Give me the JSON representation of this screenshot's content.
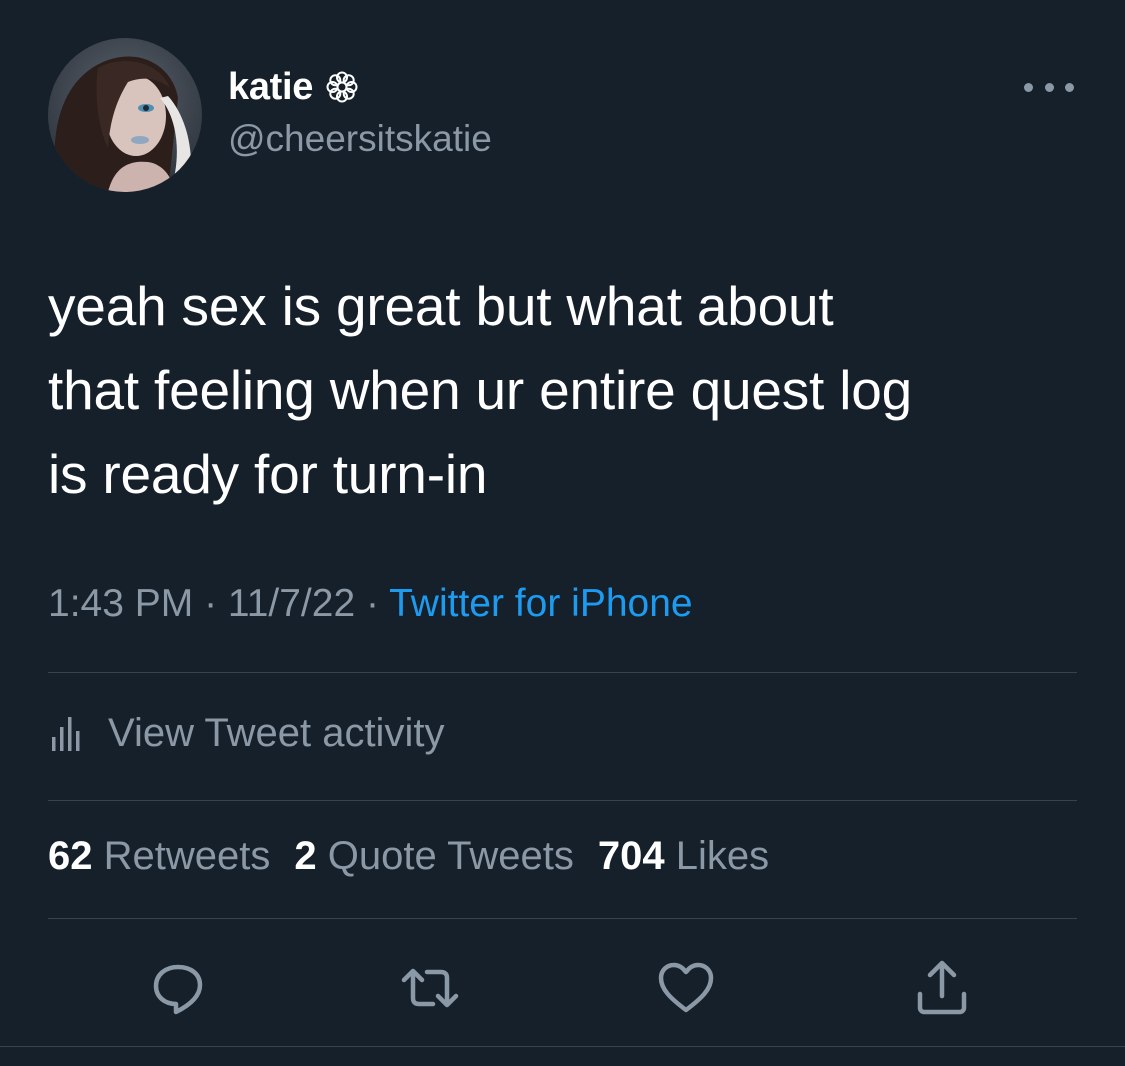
{
  "tweet": {
    "author": {
      "display_name": "katie",
      "handle": "@cheersitskatie",
      "badge_icon": "flower-icon",
      "avatar": "profile-photo"
    },
    "text": "yeah sex is great but what about\nthat feeling when ur entire quest log\nis ready for turn-in",
    "time": "1:43 PM",
    "separator": " · ",
    "date": "11/7/22",
    "source": "Twitter for iPhone",
    "activity_label": "View Tweet activity",
    "stats": {
      "retweets_count": "62",
      "retweets_label": "Retweets",
      "quotes_count": "2",
      "quotes_label": "Quote Tweets",
      "likes_count": "704",
      "likes_label": "Likes"
    },
    "actions": [
      "reply-icon",
      "retweet-icon",
      "like-icon",
      "share-icon"
    ]
  },
  "colors": {
    "background": "#15202b",
    "primary_text": "#ffffff",
    "secondary_text": "#8b98a5",
    "link": "#1d9bf0",
    "divider": "#38444d"
  }
}
